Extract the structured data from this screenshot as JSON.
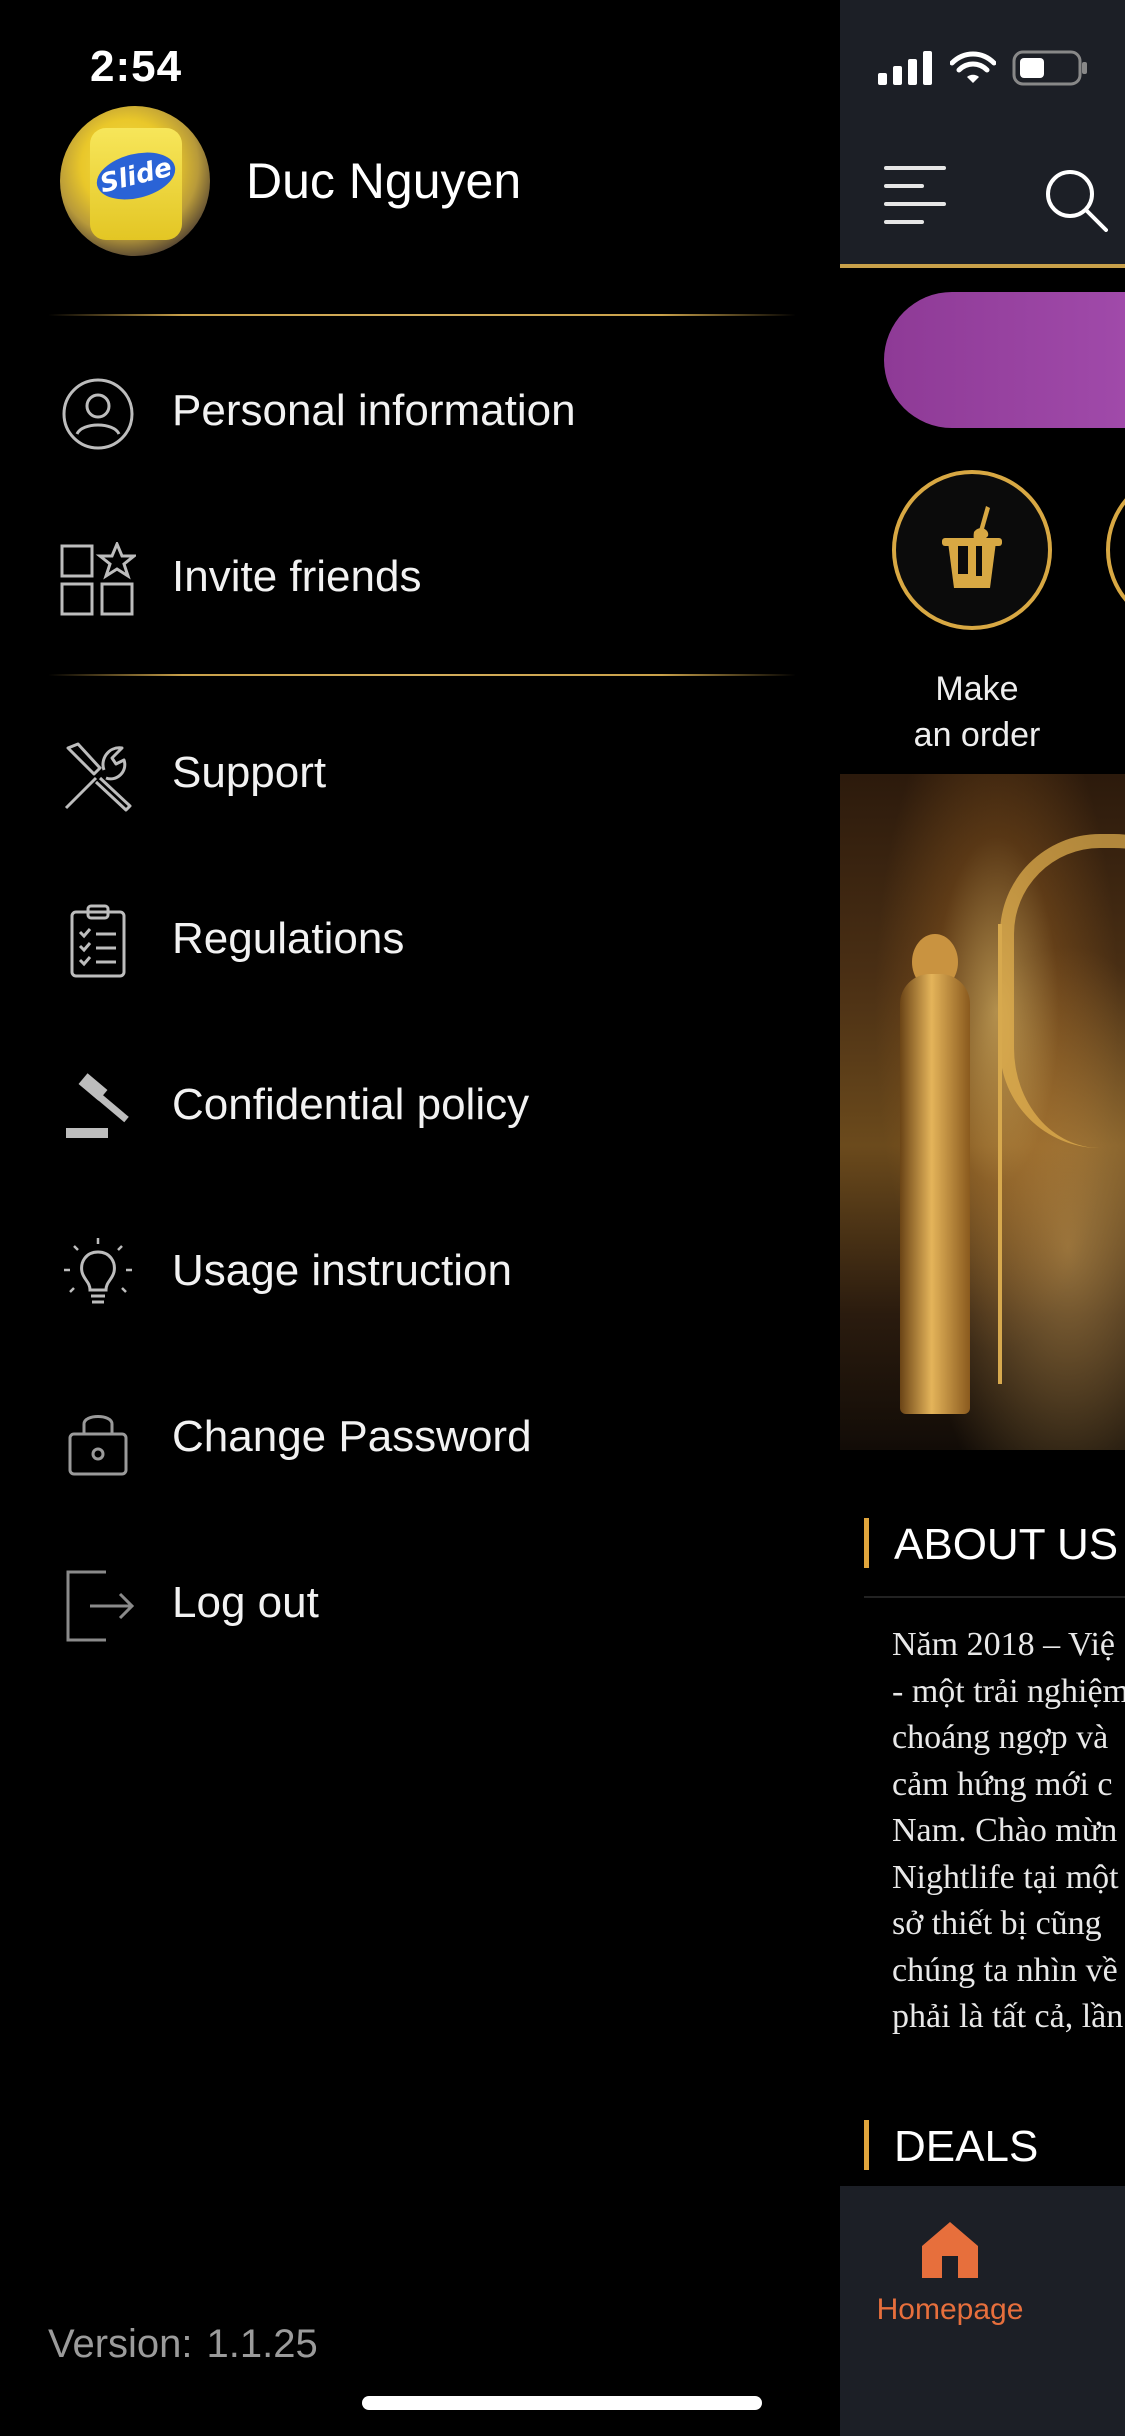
{
  "status_bar": {
    "time": "2:54"
  },
  "profile": {
    "name": "Duc Nguyen",
    "avatar_text": "Slide"
  },
  "drawer": {
    "items": [
      {
        "label": "Personal information",
        "icon": "user-circle-icon"
      },
      {
        "label": "Invite friends",
        "icon": "grid-star-icon"
      },
      {
        "label": "Support",
        "icon": "wrench-screwdriver-icon"
      },
      {
        "label": "Regulations",
        "icon": "clipboard-checklist-icon"
      },
      {
        "label": "Confidential policy",
        "icon": "gavel-icon"
      },
      {
        "label": "Usage instruction",
        "icon": "lightbulb-icon"
      },
      {
        "label": "Change Password",
        "icon": "lock-icon"
      },
      {
        "label": "Log out",
        "icon": "logout-icon"
      }
    ],
    "version_label": "Version:",
    "version_number": "1.1.25"
  },
  "main": {
    "quick_actions": [
      {
        "label_line1": "Make",
        "label_line2": "an order",
        "icon": "champagne-bucket-icon"
      }
    ],
    "sections": {
      "about_title": "ABOUT US",
      "deals_title": "DEALS"
    },
    "about_lines": [
      "Năm 2018 – Việ",
      "- một trải nghiệm",
      "choáng ngợp và",
      "cảm hứng mới c",
      "Nam. Chào mừn",
      "Nightlife tại một",
      "sở thiết bị cũng",
      "chúng ta nhìn về",
      "phải là tất cả, lần"
    ],
    "bottom_nav": {
      "home_label": "Homepage"
    }
  },
  "colors": {
    "accent_gold": "#d8a843",
    "nav_active": "#e76f3c",
    "promo_purple": "#a64fb0",
    "topbar_bg": "#1c1f26"
  }
}
